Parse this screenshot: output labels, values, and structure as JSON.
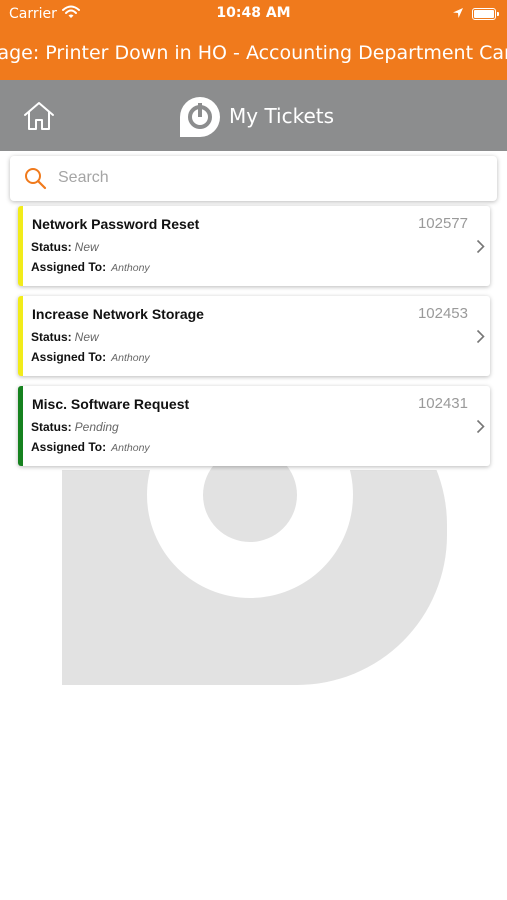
{
  "status_bar": {
    "carrier": "Carrier",
    "time": "10:48 AM"
  },
  "banner": {
    "text": "Outage: Printer Down in HO - Accounting Department Can't Print - Error messages"
  },
  "nav": {
    "title": "My Tickets"
  },
  "search": {
    "placeholder": "Search"
  },
  "tickets": [
    {
      "title": "Network Password Reset",
      "number": "102577",
      "status_label": "Status:",
      "status": "New",
      "assigned_label": "Assigned To:",
      "assigned": "Anthony",
      "color": "#f2ec1a"
    },
    {
      "title": "Increase Network Storage",
      "number": "102453",
      "status_label": "Status:",
      "status": "New",
      "assigned_label": "Assigned To:",
      "assigned": "Anthony",
      "color": "#f2ec1a"
    },
    {
      "title": "Misc. Software Request",
      "number": "102431",
      "status_label": "Status:",
      "status": "Pending",
      "assigned_label": "Assigned To:",
      "assigned": "Anthony",
      "color": "#16821f"
    }
  ],
  "colors": {
    "brand_orange": "#f07a1c",
    "nav_gray": "#8c8d8e",
    "search_icon": "#f07a1c"
  },
  "icons": [
    "wifi-icon",
    "location-arrow-icon",
    "battery-icon",
    "home-icon",
    "app-logo-icon",
    "search-icon",
    "chevron-right-icon"
  ]
}
